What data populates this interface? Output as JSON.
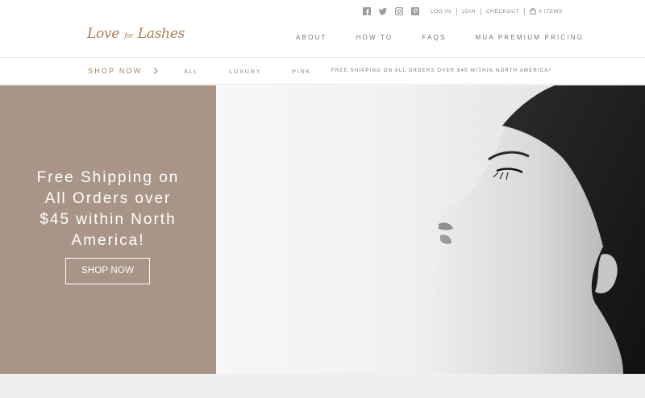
{
  "header": {
    "logo_text": "Love for Lashes",
    "logo_prefix": "Love",
    "logo_mid": "for",
    "logo_suffix": "Lashes",
    "social_icons": [
      "facebook-icon",
      "twitter-icon",
      "instagram-icon",
      "pinterest-icon"
    ],
    "utility_links": {
      "login": "LOG IN",
      "join": "JOIN",
      "checkout": "CHECKOUT",
      "cart": "0 ITEMS"
    },
    "main_nav": [
      "ABOUT",
      "HOW TO",
      "FAQS",
      "MUA PREMIUM PRICING"
    ]
  },
  "subnav": {
    "shop_now": "SHOP NOW",
    "categories": [
      "ALL",
      "LUXURY",
      "PINK"
    ],
    "promo": "FREE SHIPPING ON ALL ORDERS OVER $45 WITHIN NORTH AMERICA!"
  },
  "hero": {
    "headline_lines": [
      "Free Shipping on",
      "All Orders over",
      "$45 within North",
      "America!"
    ],
    "button_label": "SHOP NOW",
    "panel_color": "#a99587"
  },
  "colors": {
    "accent": "#a67f56",
    "panel": "#a99587"
  }
}
